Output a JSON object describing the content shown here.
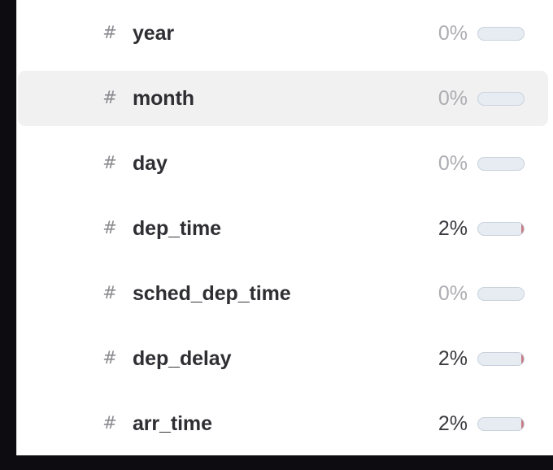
{
  "panel": {
    "name": "column-summary-panel",
    "highlighted_row_index": 1,
    "colors": {
      "panel_background": "#ffffff",
      "surround_background": "#0d0d11",
      "row_highlight": "#f1f1f1",
      "column_name_text": "#2e2e33",
      "type_icon": "#8b8b90",
      "percent_zero_text": "#adadb2",
      "percent_nonzero_text": "#3a3a3f",
      "bar_fill": "#e7ecf2",
      "bar_border": "#c9d2dc",
      "bar_missing": "#c77d86"
    }
  },
  "columns": [
    {
      "type_icon": "hash-icon",
      "type_glyph": "#",
      "name": "year",
      "missing_percent_label": "0%",
      "missing_percent_value": 0
    },
    {
      "type_icon": "hash-icon",
      "type_glyph": "#",
      "name": "month",
      "missing_percent_label": "0%",
      "missing_percent_value": 0
    },
    {
      "type_icon": "hash-icon",
      "type_glyph": "#",
      "name": "day",
      "missing_percent_label": "0%",
      "missing_percent_value": 0
    },
    {
      "type_icon": "hash-icon",
      "type_glyph": "#",
      "name": "dep_time",
      "missing_percent_label": "2%",
      "missing_percent_value": 2
    },
    {
      "type_icon": "hash-icon",
      "type_glyph": "#",
      "name": "sched_dep_time",
      "missing_percent_label": "0%",
      "missing_percent_value": 0
    },
    {
      "type_icon": "hash-icon",
      "type_glyph": "#",
      "name": "dep_delay",
      "missing_percent_label": "2%",
      "missing_percent_value": 2
    },
    {
      "type_icon": "hash-icon",
      "type_glyph": "#",
      "name": "arr_time",
      "missing_percent_label": "2%",
      "missing_percent_value": 2
    }
  ]
}
